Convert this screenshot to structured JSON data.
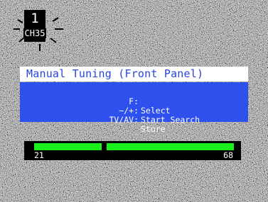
{
  "channel": {
    "number": "1",
    "label": "CH35"
  },
  "menu": {
    "title": "Manual Tuning (Front Panel)",
    "rows": [
      {
        "key": "F:",
        "action": "Select"
      },
      {
        "key": "−/+:",
        "action": "Start Search"
      },
      {
        "key": "TV/AV:",
        "action": "Store"
      }
    ]
  },
  "tuning_bar": {
    "min_label": "21",
    "max_label": "68",
    "current_position_fraction": 0.35
  },
  "colors": {
    "title_background": "#ffffff",
    "title_text": "#2844e4",
    "body_background": "#2e50ec",
    "bar_fill": "#1cf01c"
  }
}
